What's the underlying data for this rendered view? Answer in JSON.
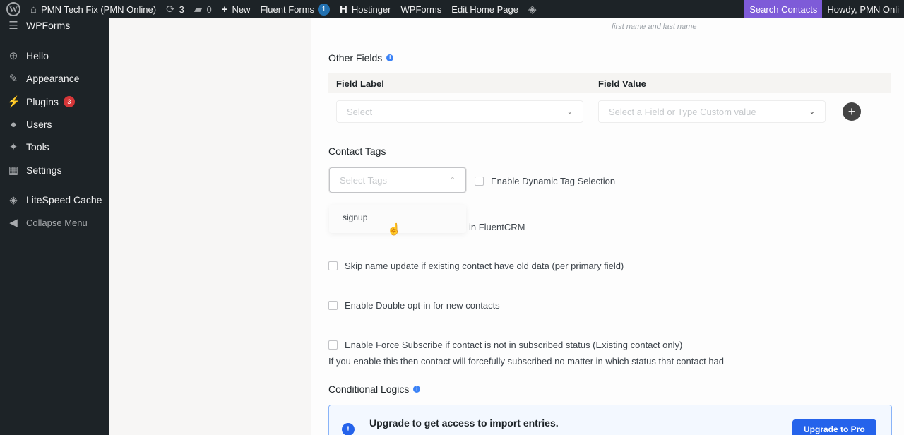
{
  "admin_bar": {
    "site_name": "PMN Tech Fix (PMN Online)",
    "updates_count": "3",
    "comments_count": "0",
    "new_label": "New",
    "fluent_forms_label": "Fluent Forms",
    "fluent_forms_badge": "1",
    "hostinger_label": "Hostinger",
    "wpforms_label": "WPForms",
    "edit_page_label": "Edit Home Page",
    "search_contacts_label": "Search Contacts",
    "howdy_label": "Howdy, PMN Onli"
  },
  "sidebar": {
    "partial_item": "WPForms",
    "items": [
      {
        "label": "Hello",
        "icon": "plus-circle-icon"
      },
      {
        "label": "Appearance",
        "icon": "brush-icon"
      },
      {
        "label": "Plugins",
        "icon": "plug-icon",
        "count": "3"
      },
      {
        "label": "Users",
        "icon": "user-icon"
      },
      {
        "label": "Tools",
        "icon": "wrench-icon"
      },
      {
        "label": "Settings",
        "icon": "settings-icon"
      },
      {
        "label": "LiteSpeed Cache",
        "icon": "litespeed-icon"
      }
    ],
    "collapse_label": "Collapse Menu"
  },
  "form": {
    "name_hint": "first name and last name",
    "other_fields": {
      "title": "Other Fields",
      "col_label": "Field Label",
      "col_value": "Field Value",
      "label_placeholder": "Select",
      "value_placeholder": "Select a Field or Type Custom value"
    },
    "contact_tags": {
      "title": "Contact Tags",
      "placeholder": "Select Tags",
      "dynamic_label": "Enable Dynamic Tag Selection",
      "dropdown_option": "signup",
      "partial_text": "in FluentCRM"
    },
    "options": {
      "skip_name": "Skip name update if existing contact have old data (per primary field)",
      "double_optin": "Enable Double opt-in for new contacts",
      "force_subscribe": "Enable Force Subscribe if contact is not in subscribed status (Existing contact only)",
      "force_subscribe_help": "If you enable this then contact will forcefully subscribed no matter in which status that contact had"
    },
    "conditional_logics": {
      "title": "Conditional Logics"
    },
    "upgrade": {
      "title": "Upgrade to get access to import entries.",
      "button": "Upgrade to Pro"
    }
  },
  "colors": {
    "admin_bar_bg": "#1d2327",
    "accent_purple": "#7e5bd8",
    "accent_blue": "#2563eb",
    "badge_red": "#d63638"
  }
}
